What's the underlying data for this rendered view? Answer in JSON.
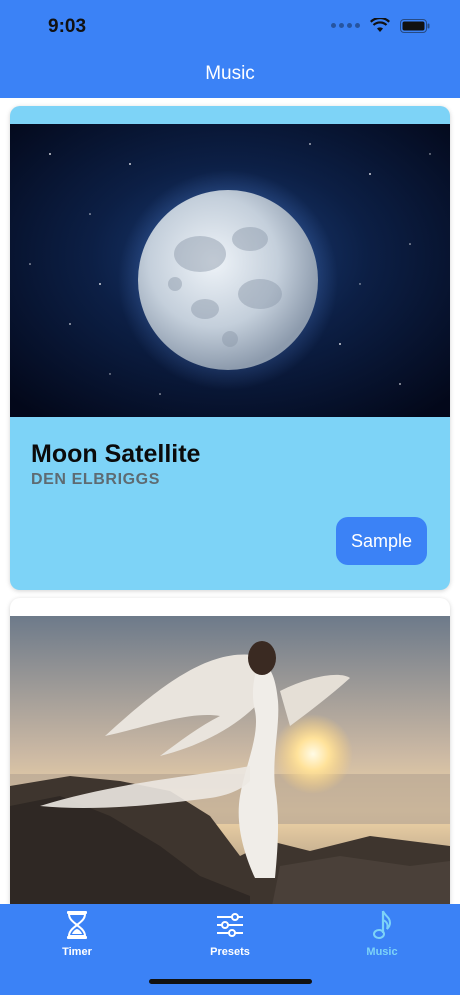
{
  "status_bar": {
    "time": "9:03"
  },
  "nav": {
    "title": "Music"
  },
  "cards": [
    {
      "title": "Moon Satellite",
      "artist": "DEN ELBRIGGS",
      "button_label": "Sample",
      "image": "full-moon-night-sky"
    },
    {
      "image": "winged-woman-sunset-rocks"
    }
  ],
  "tabbar": {
    "tabs": [
      {
        "label": "Timer",
        "icon": "hourglass-icon"
      },
      {
        "label": "Presets",
        "icon": "sliders-icon"
      },
      {
        "label": "Music",
        "icon": "music-note-icon",
        "selected": true
      }
    ]
  },
  "colors": {
    "accent": "#3b82f6",
    "card_highlight": "#7dd3f7",
    "selected_tab": "#7dd3f7"
  }
}
